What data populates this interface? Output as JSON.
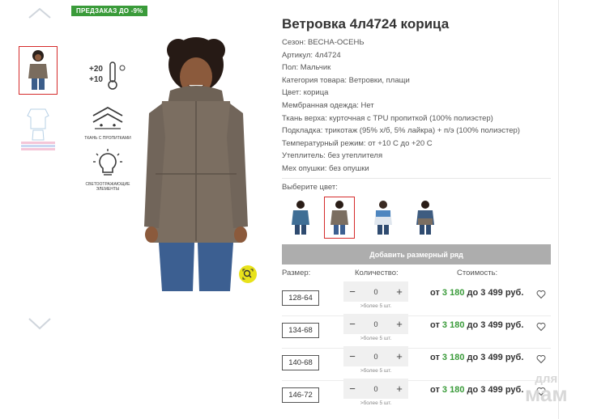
{
  "product": {
    "promo_badge": "ПРЕДЗАКАЗ ДО -9%",
    "title": "Ветровка 4л4724 корица",
    "attributes": [
      "Сезон: ВЕСНА-ОСЕНЬ",
      "Артикул: 4л4724",
      "Пол: Мальчик",
      "Категория товара: Ветровки, плащи",
      "Цвет: корица",
      "Мембранная одежда: Нет",
      "Ткань верха: курточная с TPU пропиткой (100% полиэстер)",
      "Подкладка: трикотаж (95% х/б, 5% лайкра) + п/э (100% полиэстер)",
      "Температурный режим: от +10 С до +20 С",
      "Утеплитель: без утеплителя",
      "Мех опушки: без опушки"
    ]
  },
  "feature_icons": {
    "temp_top": "+20",
    "temp_bottom": "+10",
    "fabric_caption": "ТКАНЬ С ПРОПИТКАМИ",
    "reflective_caption": "СВЕТООТРАЖАЮЩИЕ ЭЛЕМЕНТЫ"
  },
  "colors": {
    "label": "Выберите цвет:",
    "selected_index": 1,
    "swatches": [
      "blue",
      "cinnamon",
      "white-blue",
      "blue-brown"
    ]
  },
  "actions": {
    "add_size_row": "Добавить размерный ряд"
  },
  "table": {
    "size_header": "Размер:",
    "qty_header": "Количество:",
    "price_header": "Стоимость:",
    "rows": [
      {
        "size": "128-64",
        "qty": "0",
        "note": ">более 5 шт.",
        "price_prefix": "от",
        "price_min": "3 180",
        "price_mid": "до",
        "price_max": "3 499",
        "currency": "руб."
      },
      {
        "size": "134-68",
        "qty": "0",
        "note": ">более 5 шт.",
        "price_prefix": "от",
        "price_min": "3 180",
        "price_mid": "до",
        "price_max": "3 499",
        "currency": "руб."
      },
      {
        "size": "140-68",
        "qty": "0",
        "note": ">более 5 шт.",
        "price_prefix": "от",
        "price_min": "3 180",
        "price_mid": "до",
        "price_max": "3 499",
        "currency": "руб."
      },
      {
        "size": "146-72",
        "qty": "0",
        "note": ">более 5 шт.",
        "price_prefix": "от",
        "price_min": "3 180",
        "price_mid": "до",
        "price_max": "3 499",
        "currency": "руб."
      }
    ]
  },
  "stepper": {
    "minus": "−",
    "plus": "+"
  },
  "watermark": {
    "line1": "для",
    "line2": "мам"
  },
  "colors_theme": {
    "accent_green": "#3a9b3a",
    "selection_red": "#d52b2b",
    "button_gray": "#adadad"
  }
}
